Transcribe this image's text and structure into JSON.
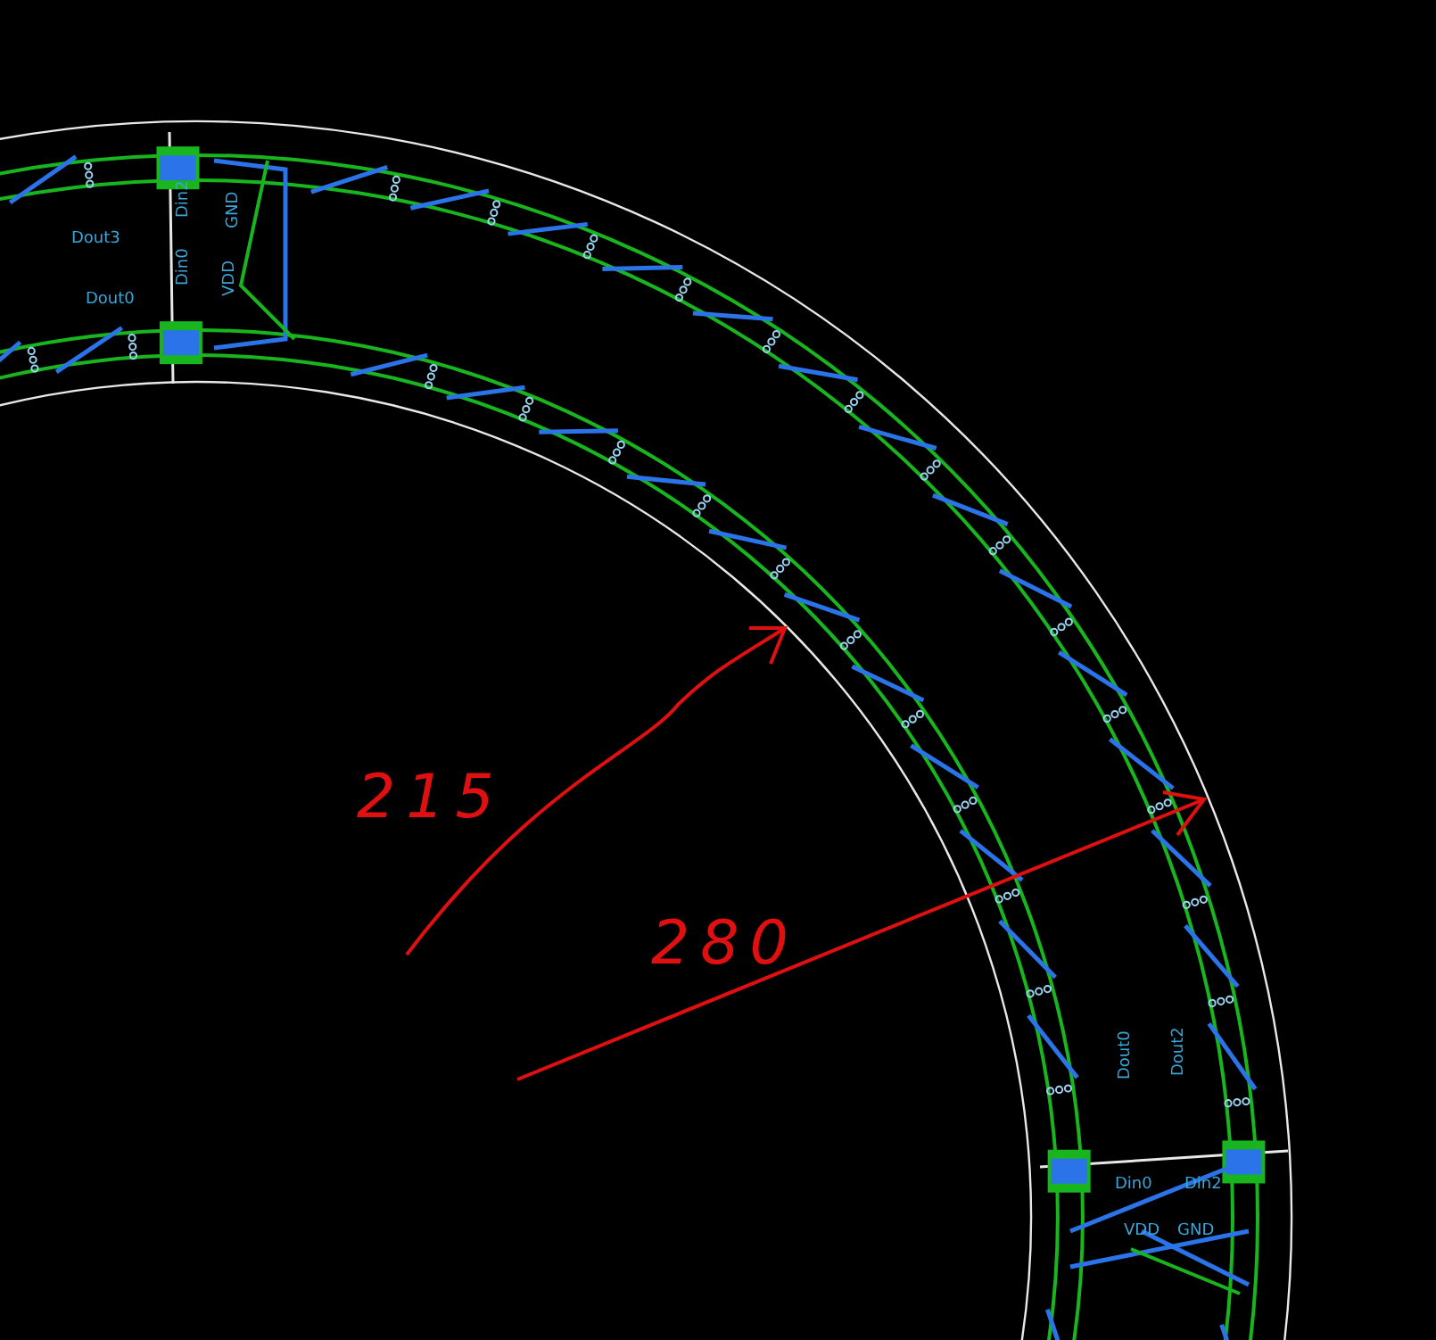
{
  "silkscreen_labels": [
    {
      "text": "Dout3"
    },
    {
      "text": "Dout0"
    },
    {
      "text": "Din2"
    },
    {
      "text": "Din0"
    },
    {
      "text": "GND"
    },
    {
      "text": "VDD"
    },
    {
      "text": "Dout0"
    },
    {
      "text": "Dout2"
    },
    {
      "text": "Din0"
    },
    {
      "text": "Din2"
    },
    {
      "text": "VDD"
    },
    {
      "text": "GND"
    }
  ],
  "annotations": [
    {
      "label": "215"
    },
    {
      "label": "280"
    }
  ]
}
